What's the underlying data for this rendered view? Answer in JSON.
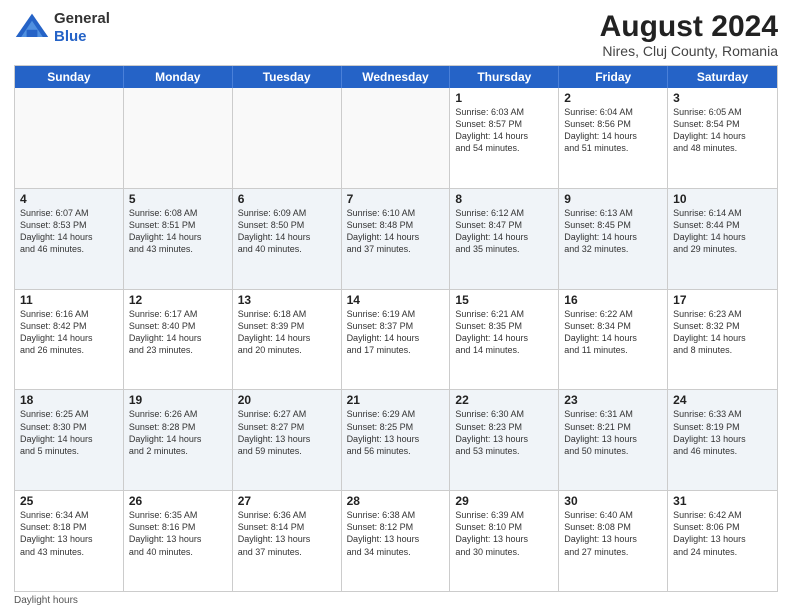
{
  "header": {
    "logo": {
      "general": "General",
      "blue": "Blue"
    },
    "month_year": "August 2024",
    "location": "Nires, Cluj County, Romania"
  },
  "days_of_week": [
    "Sunday",
    "Monday",
    "Tuesday",
    "Wednesday",
    "Thursday",
    "Friday",
    "Saturday"
  ],
  "weeks": [
    [
      {
        "day": "",
        "info": ""
      },
      {
        "day": "",
        "info": ""
      },
      {
        "day": "",
        "info": ""
      },
      {
        "day": "",
        "info": ""
      },
      {
        "day": "1",
        "info": "Sunrise: 6:03 AM\nSunset: 8:57 PM\nDaylight: 14 hours\nand 54 minutes."
      },
      {
        "day": "2",
        "info": "Sunrise: 6:04 AM\nSunset: 8:56 PM\nDaylight: 14 hours\nand 51 minutes."
      },
      {
        "day": "3",
        "info": "Sunrise: 6:05 AM\nSunset: 8:54 PM\nDaylight: 14 hours\nand 48 minutes."
      }
    ],
    [
      {
        "day": "4",
        "info": "Sunrise: 6:07 AM\nSunset: 8:53 PM\nDaylight: 14 hours\nand 46 minutes."
      },
      {
        "day": "5",
        "info": "Sunrise: 6:08 AM\nSunset: 8:51 PM\nDaylight: 14 hours\nand 43 minutes."
      },
      {
        "day": "6",
        "info": "Sunrise: 6:09 AM\nSunset: 8:50 PM\nDaylight: 14 hours\nand 40 minutes."
      },
      {
        "day": "7",
        "info": "Sunrise: 6:10 AM\nSunset: 8:48 PM\nDaylight: 14 hours\nand 37 minutes."
      },
      {
        "day": "8",
        "info": "Sunrise: 6:12 AM\nSunset: 8:47 PM\nDaylight: 14 hours\nand 35 minutes."
      },
      {
        "day": "9",
        "info": "Sunrise: 6:13 AM\nSunset: 8:45 PM\nDaylight: 14 hours\nand 32 minutes."
      },
      {
        "day": "10",
        "info": "Sunrise: 6:14 AM\nSunset: 8:44 PM\nDaylight: 14 hours\nand 29 minutes."
      }
    ],
    [
      {
        "day": "11",
        "info": "Sunrise: 6:16 AM\nSunset: 8:42 PM\nDaylight: 14 hours\nand 26 minutes."
      },
      {
        "day": "12",
        "info": "Sunrise: 6:17 AM\nSunset: 8:40 PM\nDaylight: 14 hours\nand 23 minutes."
      },
      {
        "day": "13",
        "info": "Sunrise: 6:18 AM\nSunset: 8:39 PM\nDaylight: 14 hours\nand 20 minutes."
      },
      {
        "day": "14",
        "info": "Sunrise: 6:19 AM\nSunset: 8:37 PM\nDaylight: 14 hours\nand 17 minutes."
      },
      {
        "day": "15",
        "info": "Sunrise: 6:21 AM\nSunset: 8:35 PM\nDaylight: 14 hours\nand 14 minutes."
      },
      {
        "day": "16",
        "info": "Sunrise: 6:22 AM\nSunset: 8:34 PM\nDaylight: 14 hours\nand 11 minutes."
      },
      {
        "day": "17",
        "info": "Sunrise: 6:23 AM\nSunset: 8:32 PM\nDaylight: 14 hours\nand 8 minutes."
      }
    ],
    [
      {
        "day": "18",
        "info": "Sunrise: 6:25 AM\nSunset: 8:30 PM\nDaylight: 14 hours\nand 5 minutes."
      },
      {
        "day": "19",
        "info": "Sunrise: 6:26 AM\nSunset: 8:28 PM\nDaylight: 14 hours\nand 2 minutes."
      },
      {
        "day": "20",
        "info": "Sunrise: 6:27 AM\nSunset: 8:27 PM\nDaylight: 13 hours\nand 59 minutes."
      },
      {
        "day": "21",
        "info": "Sunrise: 6:29 AM\nSunset: 8:25 PM\nDaylight: 13 hours\nand 56 minutes."
      },
      {
        "day": "22",
        "info": "Sunrise: 6:30 AM\nSunset: 8:23 PM\nDaylight: 13 hours\nand 53 minutes."
      },
      {
        "day": "23",
        "info": "Sunrise: 6:31 AM\nSunset: 8:21 PM\nDaylight: 13 hours\nand 50 minutes."
      },
      {
        "day": "24",
        "info": "Sunrise: 6:33 AM\nSunset: 8:19 PM\nDaylight: 13 hours\nand 46 minutes."
      }
    ],
    [
      {
        "day": "25",
        "info": "Sunrise: 6:34 AM\nSunset: 8:18 PM\nDaylight: 13 hours\nand 43 minutes."
      },
      {
        "day": "26",
        "info": "Sunrise: 6:35 AM\nSunset: 8:16 PM\nDaylight: 13 hours\nand 40 minutes."
      },
      {
        "day": "27",
        "info": "Sunrise: 6:36 AM\nSunset: 8:14 PM\nDaylight: 13 hours\nand 37 minutes."
      },
      {
        "day": "28",
        "info": "Sunrise: 6:38 AM\nSunset: 8:12 PM\nDaylight: 13 hours\nand 34 minutes."
      },
      {
        "day": "29",
        "info": "Sunrise: 6:39 AM\nSunset: 8:10 PM\nDaylight: 13 hours\nand 30 minutes."
      },
      {
        "day": "30",
        "info": "Sunrise: 6:40 AM\nSunset: 8:08 PM\nDaylight: 13 hours\nand 27 minutes."
      },
      {
        "day": "31",
        "info": "Sunrise: 6:42 AM\nSunset: 8:06 PM\nDaylight: 13 hours\nand 24 minutes."
      }
    ]
  ],
  "footer": {
    "note": "Daylight hours"
  }
}
